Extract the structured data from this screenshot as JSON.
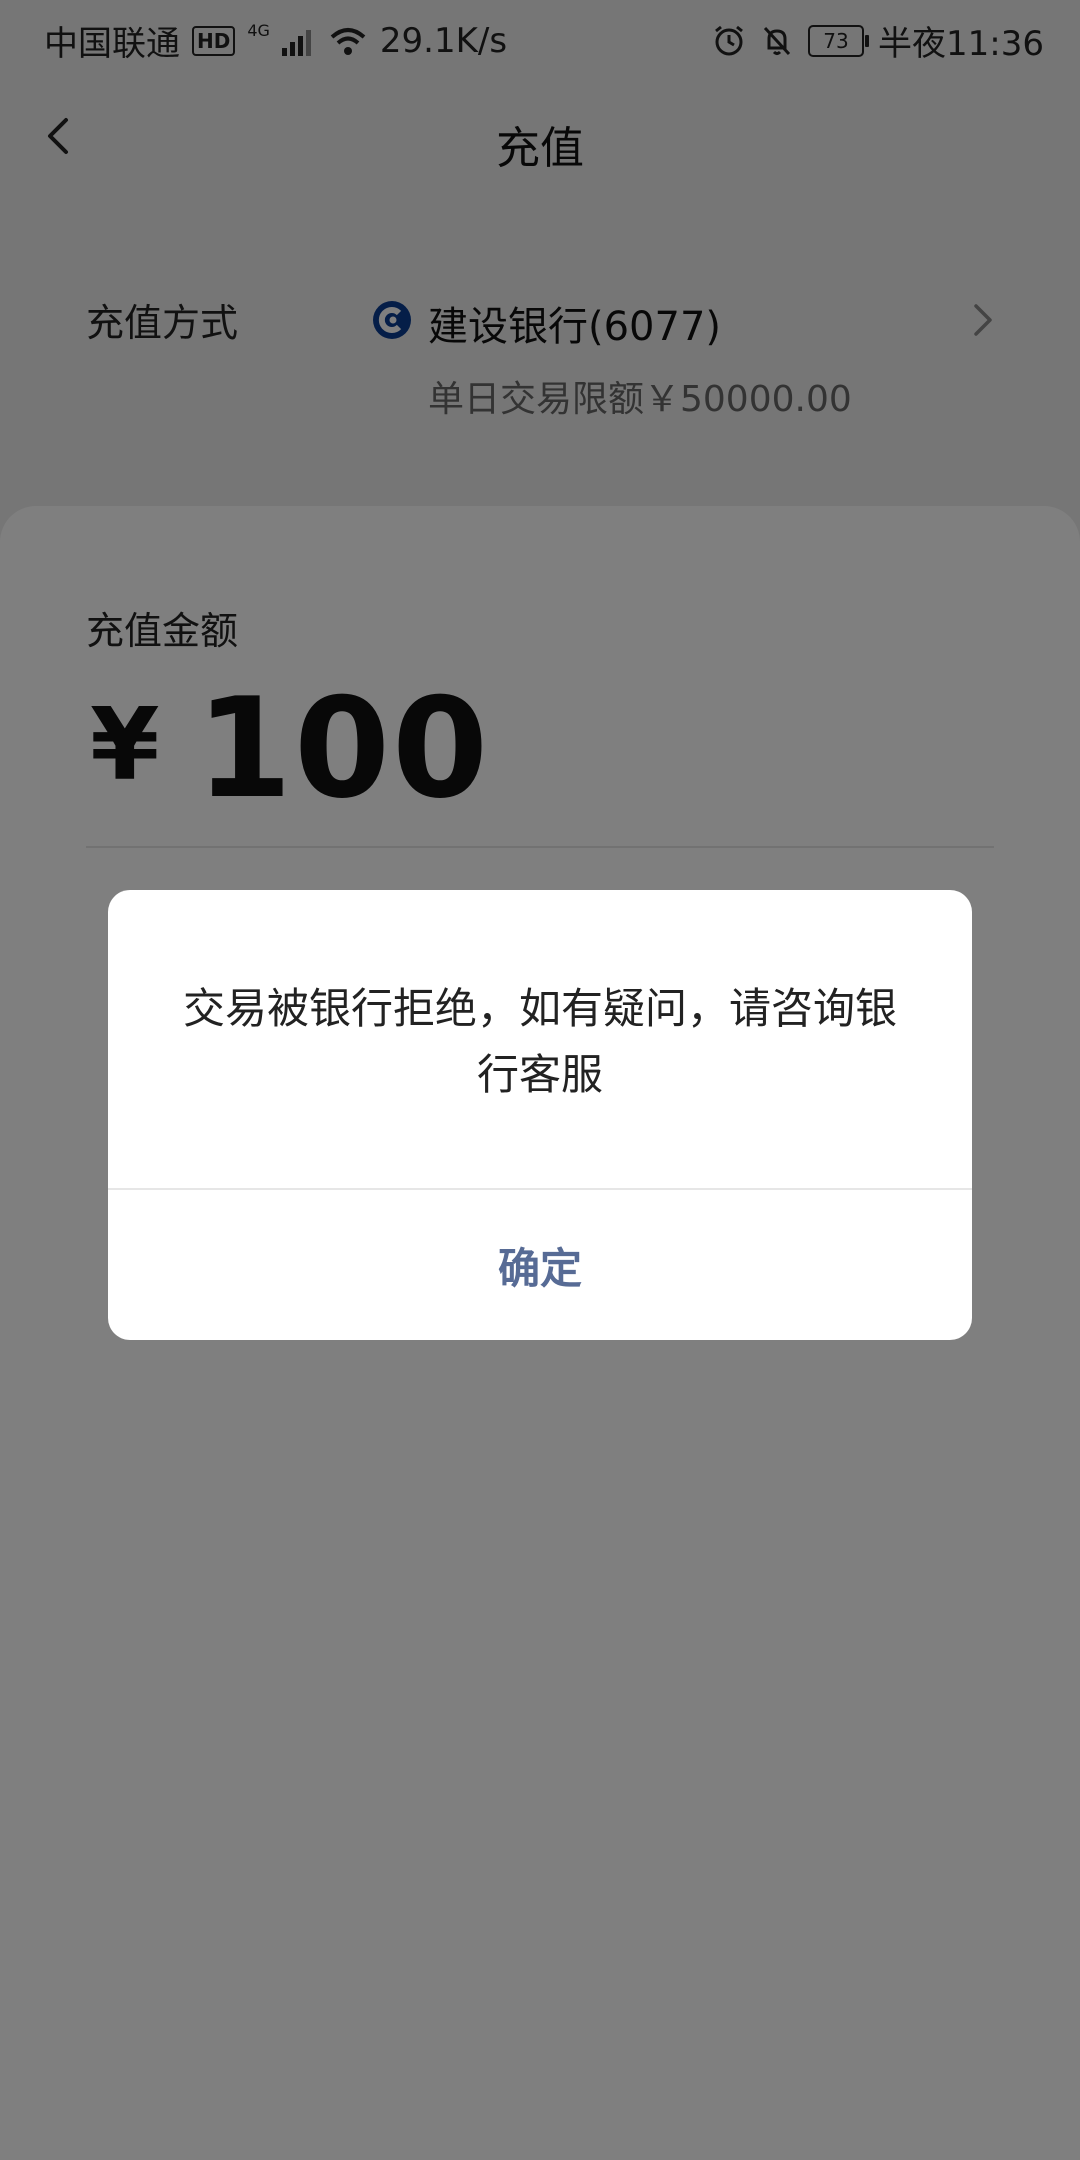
{
  "status_bar": {
    "carrier": "中国联通",
    "hd": "HD",
    "network": "4G",
    "speed": "29.1K/s",
    "battery": "73",
    "time": "半夜11:36"
  },
  "header": {
    "title": "充值"
  },
  "payment": {
    "label": "充值方式",
    "bank_name": "建设银行(6077)",
    "limit": "单日交易限额￥50000.00"
  },
  "amount": {
    "label": "充值金额",
    "currency": "¥",
    "value": "100"
  },
  "dialog": {
    "message": "交易被银行拒绝，如有疑问，请咨询银行客服",
    "confirm": "确定"
  },
  "colors": {
    "confirm_text": "#576b95",
    "bank_brand": "#0b3d91"
  },
  "icons": {
    "back": "back-arrow-icon",
    "bank": "ccb-bank-logo-icon",
    "chevron": "chevron-right-icon",
    "alarm": "alarm-icon",
    "mute": "bell-off-icon",
    "wifi": "wifi-icon",
    "signal": "signal-icon"
  }
}
